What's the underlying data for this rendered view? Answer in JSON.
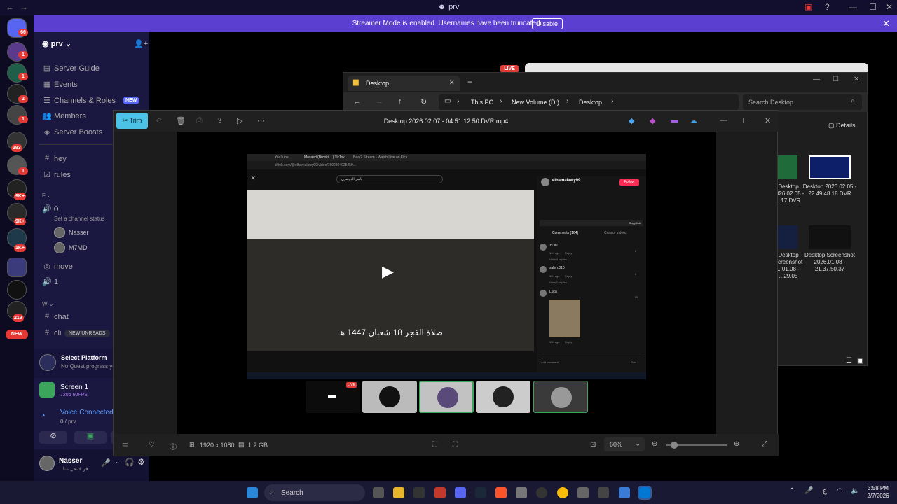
{
  "window": {
    "title": "prv"
  },
  "banner": {
    "message": "Streamer Mode is enabled. Usernames have been truncated.",
    "disable_label": "Disable"
  },
  "rail": {
    "badges": [
      "66",
      "1",
      "1",
      "2",
      "1",
      "293",
      "1",
      "9K+",
      "9K+",
      "1K+",
      "219"
    ],
    "new_label": "NEW"
  },
  "server": {
    "name": "prv"
  },
  "sidebar": {
    "items": [
      {
        "label": "Server Guide",
        "icon": "guide-icon"
      },
      {
        "label": "Events",
        "icon": "calendar-icon"
      },
      {
        "label": "Channels & Roles",
        "icon": "list-icon",
        "badge": "NEW"
      },
      {
        "label": "Members",
        "icon": "members-icon"
      },
      {
        "label": "Server Boosts",
        "icon": "boost-icon"
      }
    ],
    "channels_top": [
      {
        "label": "hey",
        "icon": "#"
      },
      {
        "label": "rules",
        "icon": "rules-icon"
      }
    ],
    "category_f": "F",
    "voice_channel": {
      "name": "0",
      "status": "Set a channel status",
      "users": [
        "Nasser",
        "M7MD"
      ]
    },
    "channels_mid": [
      {
        "label": "move"
      },
      {
        "label": "1"
      }
    ],
    "category_w": "W",
    "channels_bottom": [
      {
        "label": "chat"
      },
      {
        "label": "cli"
      }
    ],
    "new_unreads": "NEW UNREADS",
    "quest": {
      "title": "Select Platform",
      "subtitle": "No Quest progress yet"
    },
    "stream": {
      "title": "Screen 1",
      "quality": "720p 60FPS"
    },
    "voice": {
      "status": "Voice Connected",
      "channel": "0 / prv"
    },
    "user": {
      "name": "Nasser",
      "status": "...فر فاتحے عنا"
    }
  },
  "explorer": {
    "title": "Desktop",
    "breadcrumb": [
      "This PC",
      "New Volume (D:)",
      "Desktop"
    ],
    "search_placeholder": "Search Desktop",
    "details_label": "Details",
    "files": [
      {
        "name": "Desktop 2026.02.05 - 22.49.48.18.DVR"
      },
      {
        "name": "Desktop 2026.02.05 - ...17.DVR",
        "short": "Desktop"
      },
      {
        "name": "Desktop Screenshot 2026.01.08 - 21.37.50.37"
      },
      {
        "name": "Desktop Screenshot ...01.08 - ...29.05"
      }
    ],
    "live_label": "LIVE"
  },
  "player": {
    "trim_label": "Trim",
    "file_title": "Desktop 2026.02.07 - 04.51.12.50.DVR.mp4",
    "resolution": "1920 x 1080",
    "size": "1.2 GB",
    "zoom": "60%"
  },
  "inner": {
    "tabs": [
      "YouTube",
      "Mosaed (Brooki ...) TikTok",
      "Beat2 Stream - Watch Live on Kick"
    ],
    "url": "tiktok.com/@elhamalawy99/video/7602894025459...",
    "search_text": "ياسر الدوسري",
    "caption": "صلاة الفجر 18 شعبان 1447 هـ",
    "account": "elhamalawy99",
    "follow": "Follow",
    "comments_tab": "Comments (164)",
    "creator_tab": "Creator videos",
    "copy_link": "Copy link",
    "add_comment": "Add comment...",
    "post": "Post",
    "live_label": "LIVE",
    "comments": [
      {
        "user": "YUKI",
        "time": "14h ago",
        "reply": "Reply",
        "likes": "6",
        "view": "View 4 replies"
      },
      {
        "user": "saleh.010",
        "time": "12h ago",
        "reply": "Reply",
        "likes": "6",
        "view": "View 2 replies"
      },
      {
        "user": "Luca",
        "time": "13h ago",
        "reply": "Reply",
        "likes": "22"
      }
    ]
  },
  "taskbar": {
    "search_label": "Search",
    "time": "3:58 PM",
    "date": "2/7/2026"
  },
  "colors": {
    "accent": "#5b3fd0",
    "trim": "#4cc2e6",
    "live": "#e53935"
  }
}
